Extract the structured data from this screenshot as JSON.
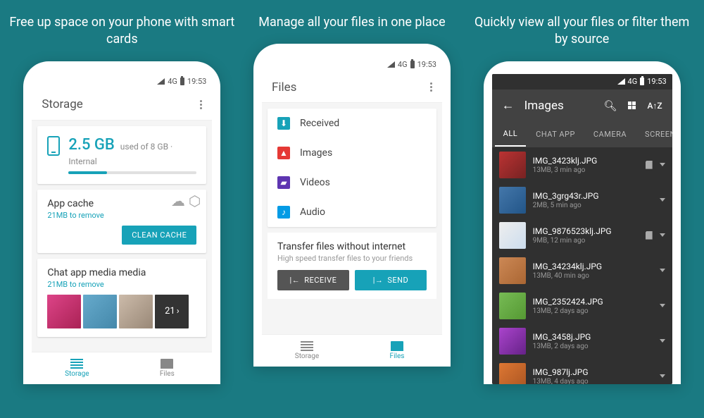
{
  "headlines": {
    "storage": "Free up space on your phone with smart cards",
    "files": "Manage all your files in one place",
    "images": "Quickly view all your files or filter them by source"
  },
  "statusbar": {
    "network": "4G",
    "time": "19:53"
  },
  "storage_screen": {
    "title": "Storage",
    "amount": "2.5 GB",
    "subtitle": "used of 8 GB · Internal",
    "cache_card": {
      "title": "App cache",
      "sub": "21MB to remove",
      "button": "CLEAN CACHE"
    },
    "media_card": {
      "title": "Chat app media media",
      "sub": "21MB to remove",
      "more_count": "21"
    },
    "nav": {
      "storage": "Storage",
      "files": "Files"
    }
  },
  "files_screen": {
    "title": "Files",
    "categories": [
      {
        "label": "Received"
      },
      {
        "label": "Images"
      },
      {
        "label": "Videos"
      },
      {
        "label": "Audio"
      }
    ],
    "transfer": {
      "title": "Transfer files without internet",
      "sub": "High speed transfer files to your friends",
      "receive": "RECEIVE",
      "send": "SEND"
    },
    "nav": {
      "storage": "Storage",
      "files": "Files"
    }
  },
  "images_screen": {
    "title": "Images",
    "tabs": [
      "ALL",
      "CHAT APP",
      "CAMERA",
      "SCREEN"
    ],
    "items": [
      {
        "name": "IMG_3423klj.JPG",
        "sub": "13MB, 3 min ago",
        "sd": true
      },
      {
        "name": "IMG_3grg43r.JPG",
        "sub": "2MB, 5 min ago",
        "sd": false
      },
      {
        "name": "IMG_9876523klj.JPG",
        "sub": "9MB, 12 min ago",
        "sd": true
      },
      {
        "name": "IMG_34234klj.JPG",
        "sub": "13MB, 40 min ago",
        "sd": false
      },
      {
        "name": "IMG_2352424.JPG",
        "sub": "13MB, 2 days ago",
        "sd": false
      },
      {
        "name": "IMG_3458j.JPG",
        "sub": "13MB, 2 days ago",
        "sd": false
      },
      {
        "name": "IMG_987lj.JPG",
        "sub": "13MB, 4 days ago",
        "sd": false
      }
    ]
  }
}
